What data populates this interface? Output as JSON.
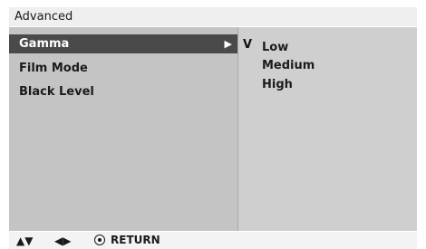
{
  "header": {
    "title": "Advanced"
  },
  "menu": {
    "items": [
      {
        "label": "Gamma",
        "selected": true,
        "submenu_arrow": "▶",
        "arrow_icon": "right-triangle-icon"
      },
      {
        "label": "Film Mode",
        "selected": false
      },
      {
        "label": "Black Level",
        "selected": false
      }
    ]
  },
  "submenu": {
    "check_mark": "V",
    "options": [
      {
        "label": "Low",
        "checked": true
      },
      {
        "label": "Medium",
        "checked": false
      },
      {
        "label": "High",
        "checked": false
      }
    ]
  },
  "footer": {
    "up_down_glyph": "▲▼",
    "up_down_icon": "up-down-arrows-icon",
    "left_right_glyph": "◀▶",
    "left_right_icon": "left-right-arrows-icon",
    "ok_icon": "ok-button-icon",
    "return_label": "RETURN"
  },
  "colors": {
    "title_bar_bg": "#efefef",
    "left_pane_bg": "#c4c4c4",
    "right_pane_bg": "#cfcfcf",
    "selected_item_bg": "#4a4a4a",
    "selected_item_text": "#ffffff",
    "text": "#1c1c1c"
  }
}
